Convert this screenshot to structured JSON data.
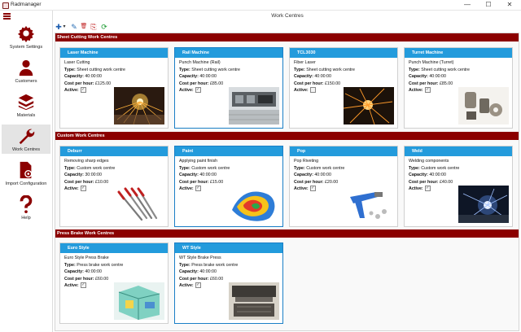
{
  "app": {
    "title": "Radmanager"
  },
  "window": {
    "minimize": "—",
    "maximize": "☐",
    "close": "✕"
  },
  "sidebar": {
    "items": [
      {
        "label": "System Settings",
        "icon": "gear-icon"
      },
      {
        "label": "Customers",
        "icon": "user-icon"
      },
      {
        "label": "Materials",
        "icon": "layers-icon"
      },
      {
        "label": "Work Centres",
        "icon": "wrench-icon",
        "active": true
      },
      {
        "label": "Import Configuration",
        "icon": "document-gear-icon"
      },
      {
        "label": "Help",
        "icon": "question-icon"
      }
    ]
  },
  "main": {
    "title": "Work Centres"
  },
  "toolbar": {
    "add": "✚",
    "dropdown": "▾",
    "edit": "✎",
    "delete": "🗑",
    "export": "⎘",
    "refresh": "⟳"
  },
  "labels": {
    "type": "Type:",
    "capacity": "Capacity:",
    "cost": "Cost per hour:",
    "active": "Active:"
  },
  "sections": [
    {
      "title": "Sheet Cutting Work Centres",
      "cards": [
        {
          "name": "Laser Machine",
          "desc": "Laser Cutting",
          "type": "Sheet cutting work centre",
          "capacity": "40:00:00",
          "cost": "£125.00",
          "active": true,
          "image": "laser-cutting"
        },
        {
          "name": "Rail Machine",
          "desc": "Punch Machine (Rail)",
          "type": "Sheet cutting work centre",
          "capacity": "40:00:00",
          "cost": "£85.00",
          "active": true,
          "image": "punch-machine",
          "selected": true
        },
        {
          "name": "TCL3030",
          "desc": "Fiber Laser",
          "type": "Sheet cutting work centre",
          "capacity": "40:00:00",
          "cost": "£150.00",
          "active": false,
          "image": "fiber-laser"
        },
        {
          "name": "Turret Machine",
          "desc": "Punch Machine (Turret)",
          "type": "Sheet cutting work centre",
          "capacity": "40:00:00",
          "cost": "£85.00",
          "active": true,
          "image": "turret-tools"
        }
      ]
    },
    {
      "title": "Custom Work Centres",
      "cards": [
        {
          "name": "Deburr",
          "desc": "Removing sharp edges",
          "type": "Custom work centre",
          "capacity": "30:00:00",
          "cost": "£10.00",
          "active": true,
          "image": "files"
        },
        {
          "name": "Paint",
          "desc": "Applying paint finish",
          "type": "Custom work centre",
          "capacity": "40:00:00",
          "cost": "£15.00",
          "active": true,
          "image": "paint",
          "selected": true
        },
        {
          "name": "Pop",
          "desc": "Pop Riveting",
          "type": "Custom work centre",
          "capacity": "40:00:00",
          "cost": "£20.00",
          "active": true,
          "image": "rivet-gun"
        },
        {
          "name": "Weld",
          "desc": "Welding components",
          "type": "Custom work centre",
          "capacity": "40:00:00",
          "cost": "£40.00",
          "active": true,
          "image": "welding"
        }
      ]
    },
    {
      "title": "Press Brake Work Centres",
      "cards": [
        {
          "name": "Euro Style",
          "desc": "Euro Style Press Brake",
          "type": "Press brake work centre",
          "capacity": "40:00:00",
          "cost": "£60.00",
          "active": true,
          "image": "press-brake-euro"
        },
        {
          "name": "WT Style",
          "desc": "WT Style Brake Press",
          "type": "Press brake work centre",
          "capacity": "40:00:00",
          "cost": "£60.00",
          "active": true,
          "image": "press-brake-wt",
          "selected": true
        }
      ]
    }
  ]
}
